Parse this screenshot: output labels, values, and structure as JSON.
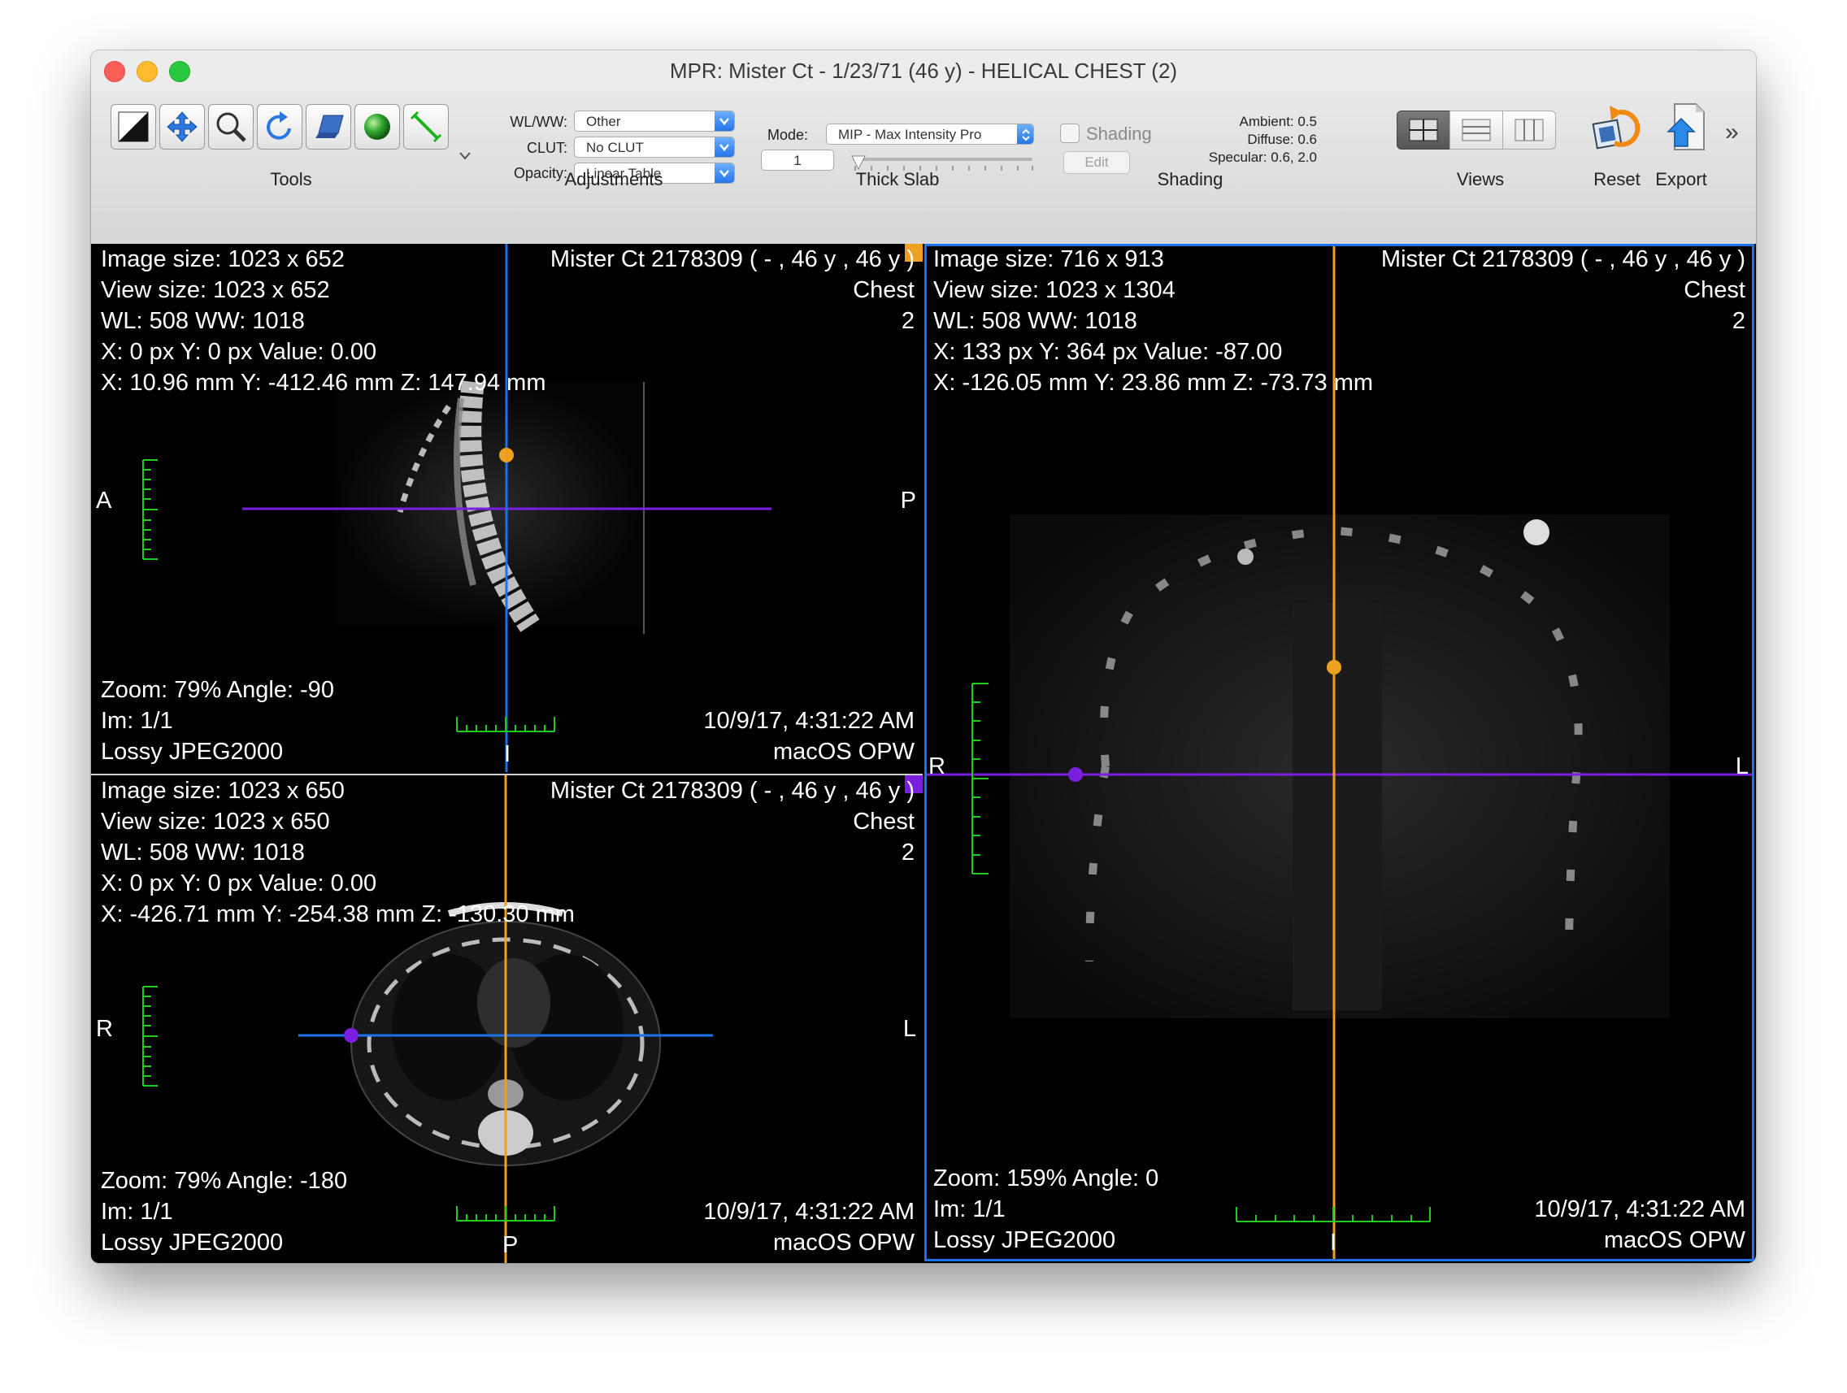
{
  "window": {
    "title": "MPR: Mister Ct - 1/23/71 (46 y) - HELICAL CHEST (2)"
  },
  "toolbar": {
    "groups": {
      "tools": "Tools",
      "adjustments": "Adjustments",
      "thick_slab": "Thick Slab",
      "shading": "Shading",
      "views": "Views",
      "reset": "Reset",
      "export": "Export"
    },
    "adjustments": {
      "wlww_label": "WL/WW:",
      "wlww_value": "Other",
      "clut_label": "CLUT:",
      "clut_value": "No CLUT",
      "opacity_label": "Opacity:",
      "opacity_value": "Linear Table"
    },
    "thick_slab": {
      "mode_label": "Mode:",
      "mode_value": "MIP - Max Intensity Pro",
      "thickness_value": "1"
    },
    "shading": {
      "checkbox_label": "Shading",
      "edit_label": "Edit",
      "ambient": "Ambient: 0.5",
      "diffuse": "Diffuse: 0.6",
      "specular": "Specular: 0.6, 2.0"
    },
    "overflow": "»"
  },
  "colors": {
    "blue_line": "#1a73e8",
    "orange_line": "#f0a020",
    "purple_line": "#7a1ee0",
    "scale_green": "#1ecc1e"
  },
  "panes": {
    "sagittal": {
      "image_size": "Image size: 1023 x 652",
      "view_size": "View size: 1023 x 652",
      "wl": "WL: 508 WW: 1018",
      "px": "X: 0 px Y: 0 px Value: 0.00",
      "mm": "X: 10.96 mm Y: -412.46 mm Z: 147.94 mm",
      "patient": "Mister Ct 2178309 (  - ,  46 y ,  46 y )",
      "study": "Chest",
      "series": "2",
      "zoom": "Zoom: 79% Angle: -90",
      "im": "Im: 1/1",
      "compression": "Lossy JPEG2000",
      "date": "10/9/17, 4:31:22 AM",
      "station": "macOS OPW",
      "orient_left": "A",
      "orient_right": "P",
      "orient_bottom": "I"
    },
    "axial": {
      "image_size": "Image size: 1023 x 650",
      "view_size": "View size: 1023 x 650",
      "wl": "WL: 508 WW: 1018",
      "px": "X: 0 px Y: 0 px Value: 0.00",
      "mm": "X: -426.71 mm Y: -254.38 mm Z: -130.30 mm",
      "patient": "Mister Ct 2178309 (  - ,  46 y ,  46 y )",
      "study": "Chest",
      "series": "2",
      "zoom": "Zoom: 79% Angle: -180",
      "im": "Im: 1/1",
      "compression": "Lossy JPEG2000",
      "date": "10/9/17, 4:31:22 AM",
      "station": "macOS OPW",
      "orient_left": "R",
      "orient_right": "L",
      "orient_bottom": "P"
    },
    "coronal": {
      "image_size": "Image size: 716 x 913",
      "view_size": "View size: 1023 x 1304",
      "wl": "WL: 508 WW: 1018",
      "px": "X: 133 px Y: 364 px Value: -87.00",
      "mm": "X: -126.05 mm Y: 23.86 mm Z: -73.73 mm",
      "patient": "Mister Ct 2178309 (  - ,  46 y ,  46 y )",
      "study": "Chest",
      "series": "2",
      "zoom": "Zoom: 159% Angle: 0",
      "im": "Im: 1/1",
      "compression": "Lossy JPEG2000",
      "date": "10/9/17, 4:31:22 AM",
      "station": "macOS OPW",
      "orient_left": "R",
      "orient_right": "L",
      "orient_bottom": "I"
    }
  }
}
